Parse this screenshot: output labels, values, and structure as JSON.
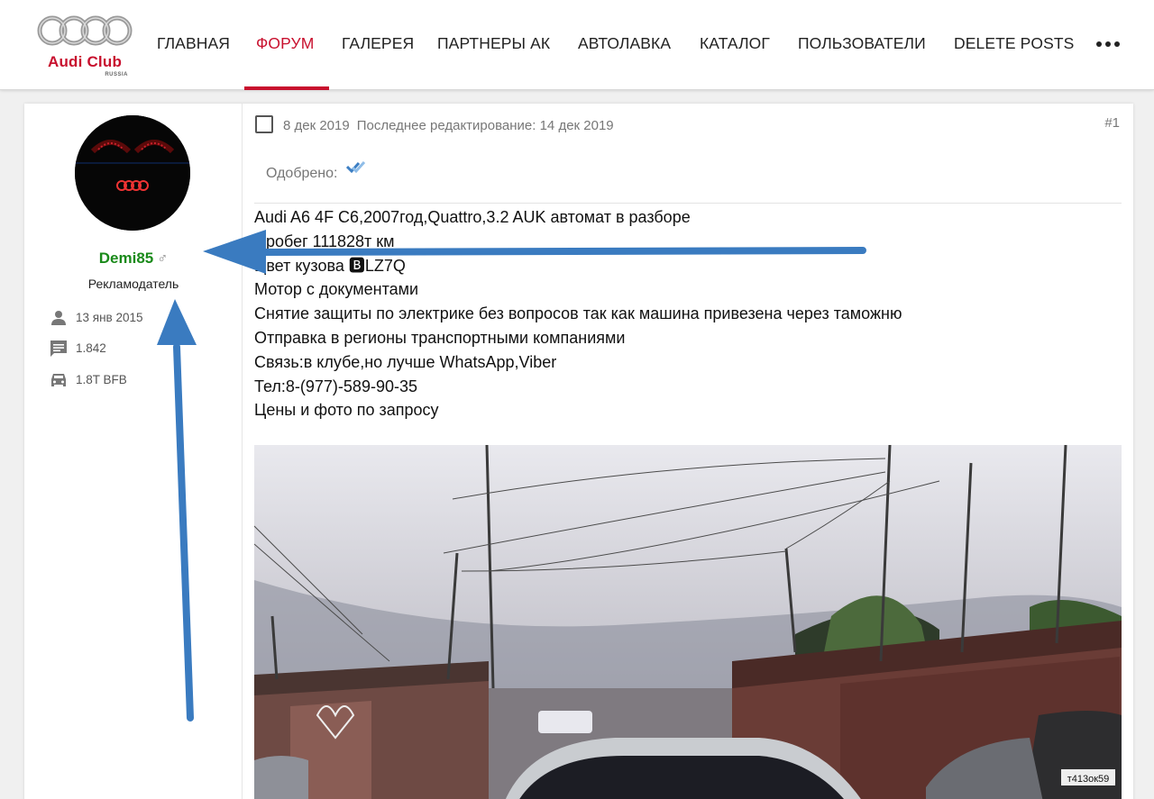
{
  "header": {
    "logo": {
      "brand": "Audi Club",
      "country": "RUSSIA"
    },
    "nav": [
      {
        "label": "ГЛАВНАЯ",
        "active": false
      },
      {
        "label": "ФОРУМ",
        "active": true
      },
      {
        "label": "ГАЛЕРЕЯ",
        "active": false
      },
      {
        "label": "ПАРТНЕРЫ АК",
        "active": false
      },
      {
        "label": "АВТОЛАВКА",
        "active": false
      },
      {
        "label": "КАТАЛОГ",
        "active": false
      },
      {
        "label": "ПОЛЬЗОВАТЕЛИ",
        "active": false
      },
      {
        "label": "DELETE POSTS",
        "active": false
      }
    ],
    "more_icon": "more-horizontal-icon",
    "accent_color": "#c8102e"
  },
  "user": {
    "username": "Demi85",
    "gender_symbol": "♂",
    "title": "Рекламодатель",
    "username_color": "#1a8a1a",
    "stats": [
      {
        "icon": "person-icon",
        "value": "13 янв 2015"
      },
      {
        "icon": "comment-icon",
        "value": "1.842"
      },
      {
        "icon": "car-icon",
        "value": "1.8T BFB"
      }
    ]
  },
  "post": {
    "date": "8 дек 2019",
    "edited": "Последнее редактирование: 14 дек 2019",
    "number": "#1",
    "approved_label": "Одобрено:",
    "approved_icon": "double-check-icon",
    "lines": [
      "Audi A6 4F C6,2007год,Quattro,3.2 AUK автомат в разборе",
      "Пробег 111828т км",
      "Цвет кузова 🅱LZ7Q",
      "Мотор с документами",
      "Снятие защиты по электрике без вопросов так как машина привезена через таможню",
      "Отправка в регионы транспортными компаниями",
      "Связь:в клубе,но лучше WhatsApp,Viber",
      "Тел:8-(977)-589-90-35",
      "Цены и фото по запросу"
    ],
    "plate_text": "т413ок59"
  },
  "annotation": {
    "arrow_color": "#3a7bc0"
  }
}
